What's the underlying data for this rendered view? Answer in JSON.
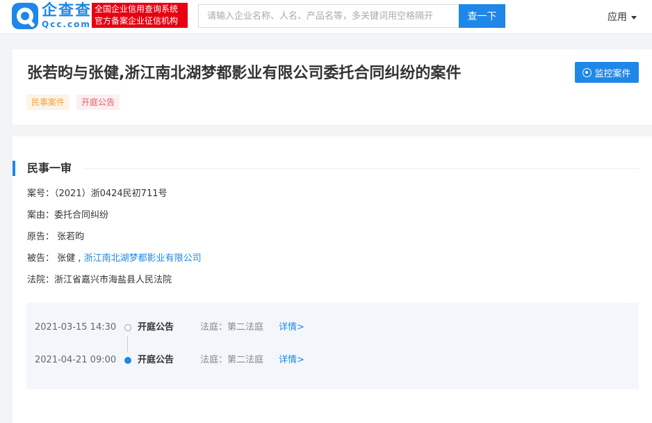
{
  "header": {
    "logo_name": "企查查",
    "logo_domain": "Qcc.com",
    "slogan_line1": "全国企业信用查询系统",
    "slogan_line2": "官方备案企业征信机构",
    "search_placeholder": "请输入企业名称、人名、产品名等，多关键词用空格隔开",
    "search_button": "查一下",
    "apps_menu": "应用"
  },
  "case": {
    "title": "张若昀与张健,浙江南北湖梦都影业有限公司委托合同纠纷的案件",
    "monitor_button": "监控案件",
    "tags": [
      "民事案件",
      "开庭公告"
    ]
  },
  "section": {
    "title": "民事一审",
    "case_number_label": "案号：",
    "case_number": "（2021）浙0424民初711号",
    "cause_label": "案由：",
    "cause": "委托合同纠纷",
    "plaintiff_label": "原告：",
    "plaintiff": "张若昀",
    "defendant_label": "被告：",
    "defendant_person": "张健 ,",
    "defendant_company": "浙江南北湖梦都影业有限公司",
    "court_label": "法院：",
    "court": "浙江省嘉兴市海盐县人民法院"
  },
  "timeline": [
    {
      "date": "2021-03-15 14:30",
      "type": "开庭公告",
      "room": "法庭：第二法庭",
      "detail": "详情>",
      "state": "hollow"
    },
    {
      "date": "2021-04-21 09:00",
      "type": "开庭公告",
      "room": "法庭：第二法庭",
      "detail": "详情>",
      "state": "filled"
    }
  ],
  "colors": {
    "brand_blue": "#1e87e8",
    "slogan_red": "#e60012",
    "tag_civil_text": "#f5a340",
    "tag_court_text": "#ea5d6a"
  }
}
